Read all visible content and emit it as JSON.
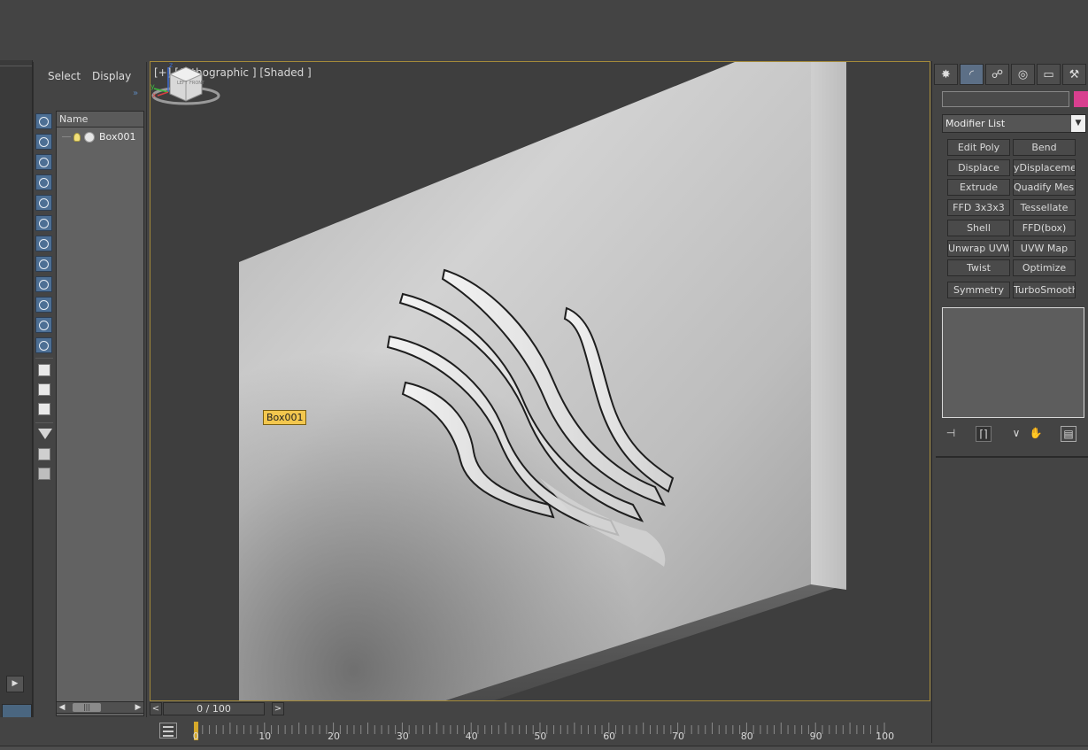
{
  "scene_explorer": {
    "tabs": [
      "Select",
      "Display"
    ],
    "column_header": "Name",
    "objects": [
      {
        "name": "Box001"
      }
    ]
  },
  "viewport": {
    "label": "[+] [Orthographic ] [Shaded ]",
    "object_tag": "Box001",
    "viewcube_faces": [
      "LEFT",
      "FRONT"
    ],
    "axes": [
      "z",
      "y",
      "x"
    ]
  },
  "timeline": {
    "prev": "<",
    "next": ">",
    "frame_display": "0 / 100",
    "current_frame": 0,
    "ticks": [
      "0",
      "10",
      "20",
      "30",
      "40",
      "50",
      "60",
      "70",
      "80",
      "90",
      "100"
    ]
  },
  "command_panel": {
    "tabs": [
      {
        "icon": "create-icon",
        "glyph": "✸"
      },
      {
        "icon": "modify-icon",
        "glyph": "◜"
      },
      {
        "icon": "hierarchy-icon",
        "glyph": "☍"
      },
      {
        "icon": "motion-icon",
        "glyph": "◎"
      },
      {
        "icon": "display-icon",
        "glyph": "▭"
      },
      {
        "icon": "utilities-icon",
        "glyph": "⚒"
      }
    ],
    "object_color": "#d83f8f",
    "modifier_list_label": "Modifier List",
    "modifier_buttons": [
      "Edit Poly",
      "Bend",
      "Displace",
      "yDisplacement",
      "Extrude",
      "Quadify Mesh",
      "FFD 3x3x3",
      "Tessellate",
      "Shell",
      "FFD(box)",
      "Unwrap UVW",
      "UVW Map",
      "Twist",
      "Optimize",
      "Symmetry",
      "TurboSmooth"
    ]
  },
  "colors": {
    "background": "#444444",
    "viewport_border": "#a48a3a",
    "object_tag": "#f3c74e",
    "toolbar_blue": "#4d6f94"
  }
}
